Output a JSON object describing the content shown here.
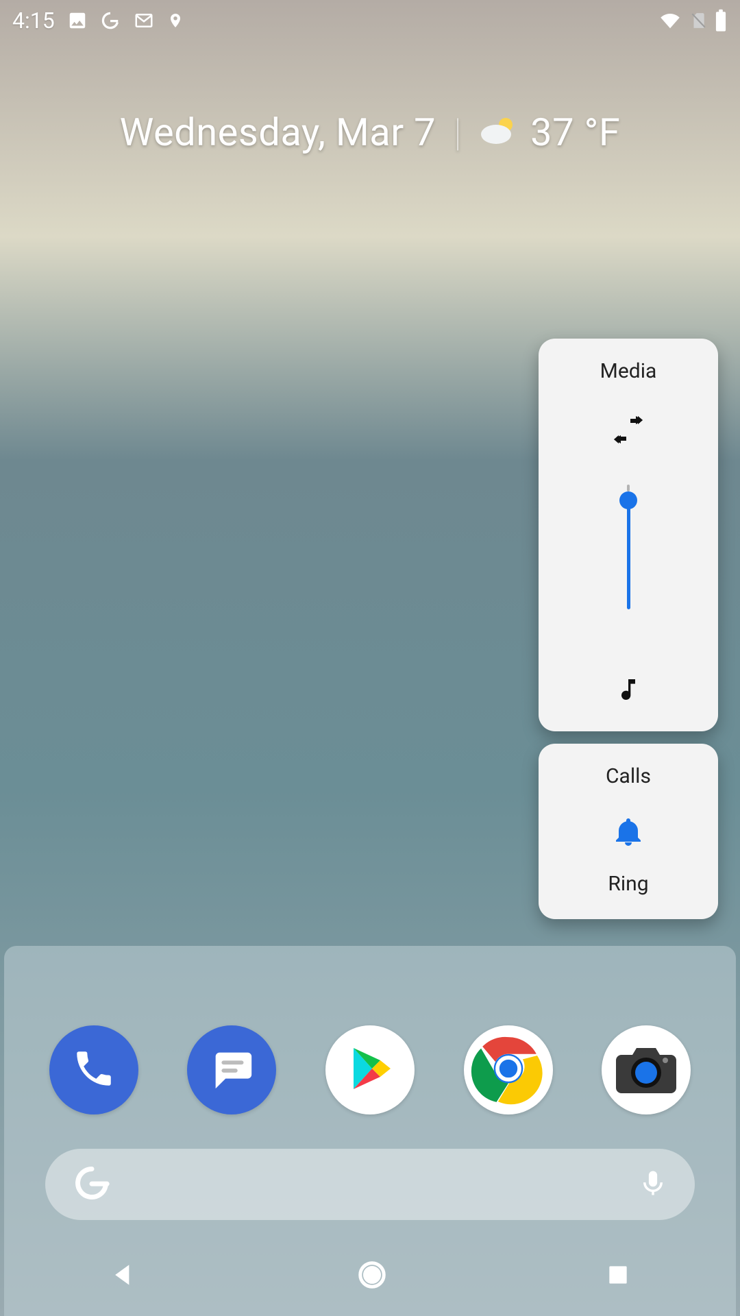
{
  "status": {
    "time": "4:15",
    "left_icons": [
      "image-icon",
      "google-g-icon",
      "gmail-icon",
      "location-icon"
    ],
    "right_icons": [
      "wifi-icon",
      "no-sim-icon",
      "battery-icon"
    ]
  },
  "widget": {
    "date": "Wednesday, Mar 7",
    "temp": "37 °F",
    "weather_icon": "partly-cloudy-icon"
  },
  "volume": {
    "media": {
      "title": "Media",
      "output_icon": "audio-output-switch-icon",
      "stream_icon": "music-note-icon",
      "slider_percent": 100
    },
    "calls": {
      "title": "Calls",
      "state_icon": "bell-icon",
      "mode_label": "Ring"
    }
  },
  "favorites": [
    {
      "name": "phone-app",
      "icon": "phone-icon",
      "bg": "blue"
    },
    {
      "name": "messages-app",
      "icon": "message-icon",
      "bg": "blue"
    },
    {
      "name": "play-store-app",
      "icon": "play-store-icon",
      "bg": "white"
    },
    {
      "name": "chrome-app",
      "icon": "chrome-icon",
      "bg": "white"
    },
    {
      "name": "camera-app",
      "icon": "camera-icon",
      "bg": "white"
    }
  ],
  "search": {
    "left_icon": "google-g-icon",
    "right_icon": "mic-icon"
  },
  "nav": {
    "back": "back-icon",
    "home": "home-icon",
    "recents": "recents-icon"
  },
  "colors": {
    "accent_blue": "#1a73e8",
    "icon_dark": "#111111"
  }
}
